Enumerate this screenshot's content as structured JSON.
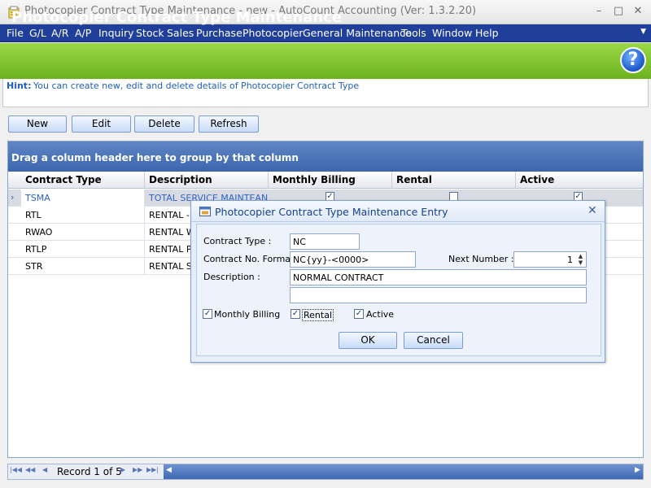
{
  "window": {
    "title": "Photocopier Contract Type Maintenance - new - AutoCount Accounting (Ver: 1.3.2.20)",
    "minimize": "–",
    "maximize": "□",
    "close": "✕"
  },
  "menu": {
    "items": [
      "File",
      "G/L",
      "A/R",
      "A/P",
      "Inquiry",
      "Stock",
      "Sales",
      "Purchase",
      "Photocopier",
      "General Maintenance",
      "Tools",
      "Window",
      "Help"
    ],
    "overflow": "▼"
  },
  "header": {
    "title": "Photocopier Contract Type Maintenance",
    "help_glyph": "?"
  },
  "hint": {
    "label": "Hint:",
    "text": "You can create new, edit and delete details of Photocopier Contract Type"
  },
  "toolbar": {
    "new_label": "New",
    "edit_label": "Edit",
    "delete_label": "Delete",
    "refresh_label": "Refresh"
  },
  "grid": {
    "group_panel_text": "Drag a column header here to group by that column",
    "columns": [
      "Contract Type",
      "Description",
      "Monthly Billing",
      "Rental",
      "Active"
    ],
    "selected_indicator": "›",
    "rows": [
      {
        "contract_type": "TSMA",
        "description": "TOTAL SERVICE MAINTEAN...",
        "monthly_billing": true,
        "rental": false,
        "active": true
      },
      {
        "contract_type": "RTL",
        "description": "RENTAL - P"
      },
      {
        "contract_type": "RWAO",
        "description": "RENTAL WI"
      },
      {
        "contract_type": "RTLP",
        "description": "RENTAL PR"
      },
      {
        "contract_type": "STR",
        "description": "RENTAL SH"
      }
    ]
  },
  "navigator": {
    "first": "|◀◀",
    "prev_page": "◀◀",
    "prev": "◀",
    "record_text": "Record 1 of 5",
    "next": "▶",
    "next_page": "▶▶",
    "last": "▶▶|",
    "scroll_left": "◀",
    "scroll_right": "▶"
  },
  "dialog": {
    "title": "Photocopier Contract Type Maintenance Entry",
    "close": "✕",
    "contract_type_label": "Contract Type :",
    "contract_type_value": "NC",
    "format_label": "Contract No. Format",
    "format_value": "NC{yy}-<0000>",
    "next_number_label": "Next Number :",
    "next_number_value": "1",
    "description_label": "Description :",
    "description_value": "NORMAL CONTRACT",
    "description2_value": "",
    "monthly_billing_label": "Monthly Billing",
    "monthly_billing_checked": true,
    "rental_label": "Rental",
    "rental_checked": true,
    "active_label": "Active",
    "active_checked": true,
    "ok_label": "OK",
    "cancel_label": "Cancel"
  },
  "colors": {
    "menu_bg": "#1f3f9b",
    "header_green": "#7cc22c",
    "link_blue": "#1f5fc0",
    "group_panel_blue": "#4a72b6"
  }
}
